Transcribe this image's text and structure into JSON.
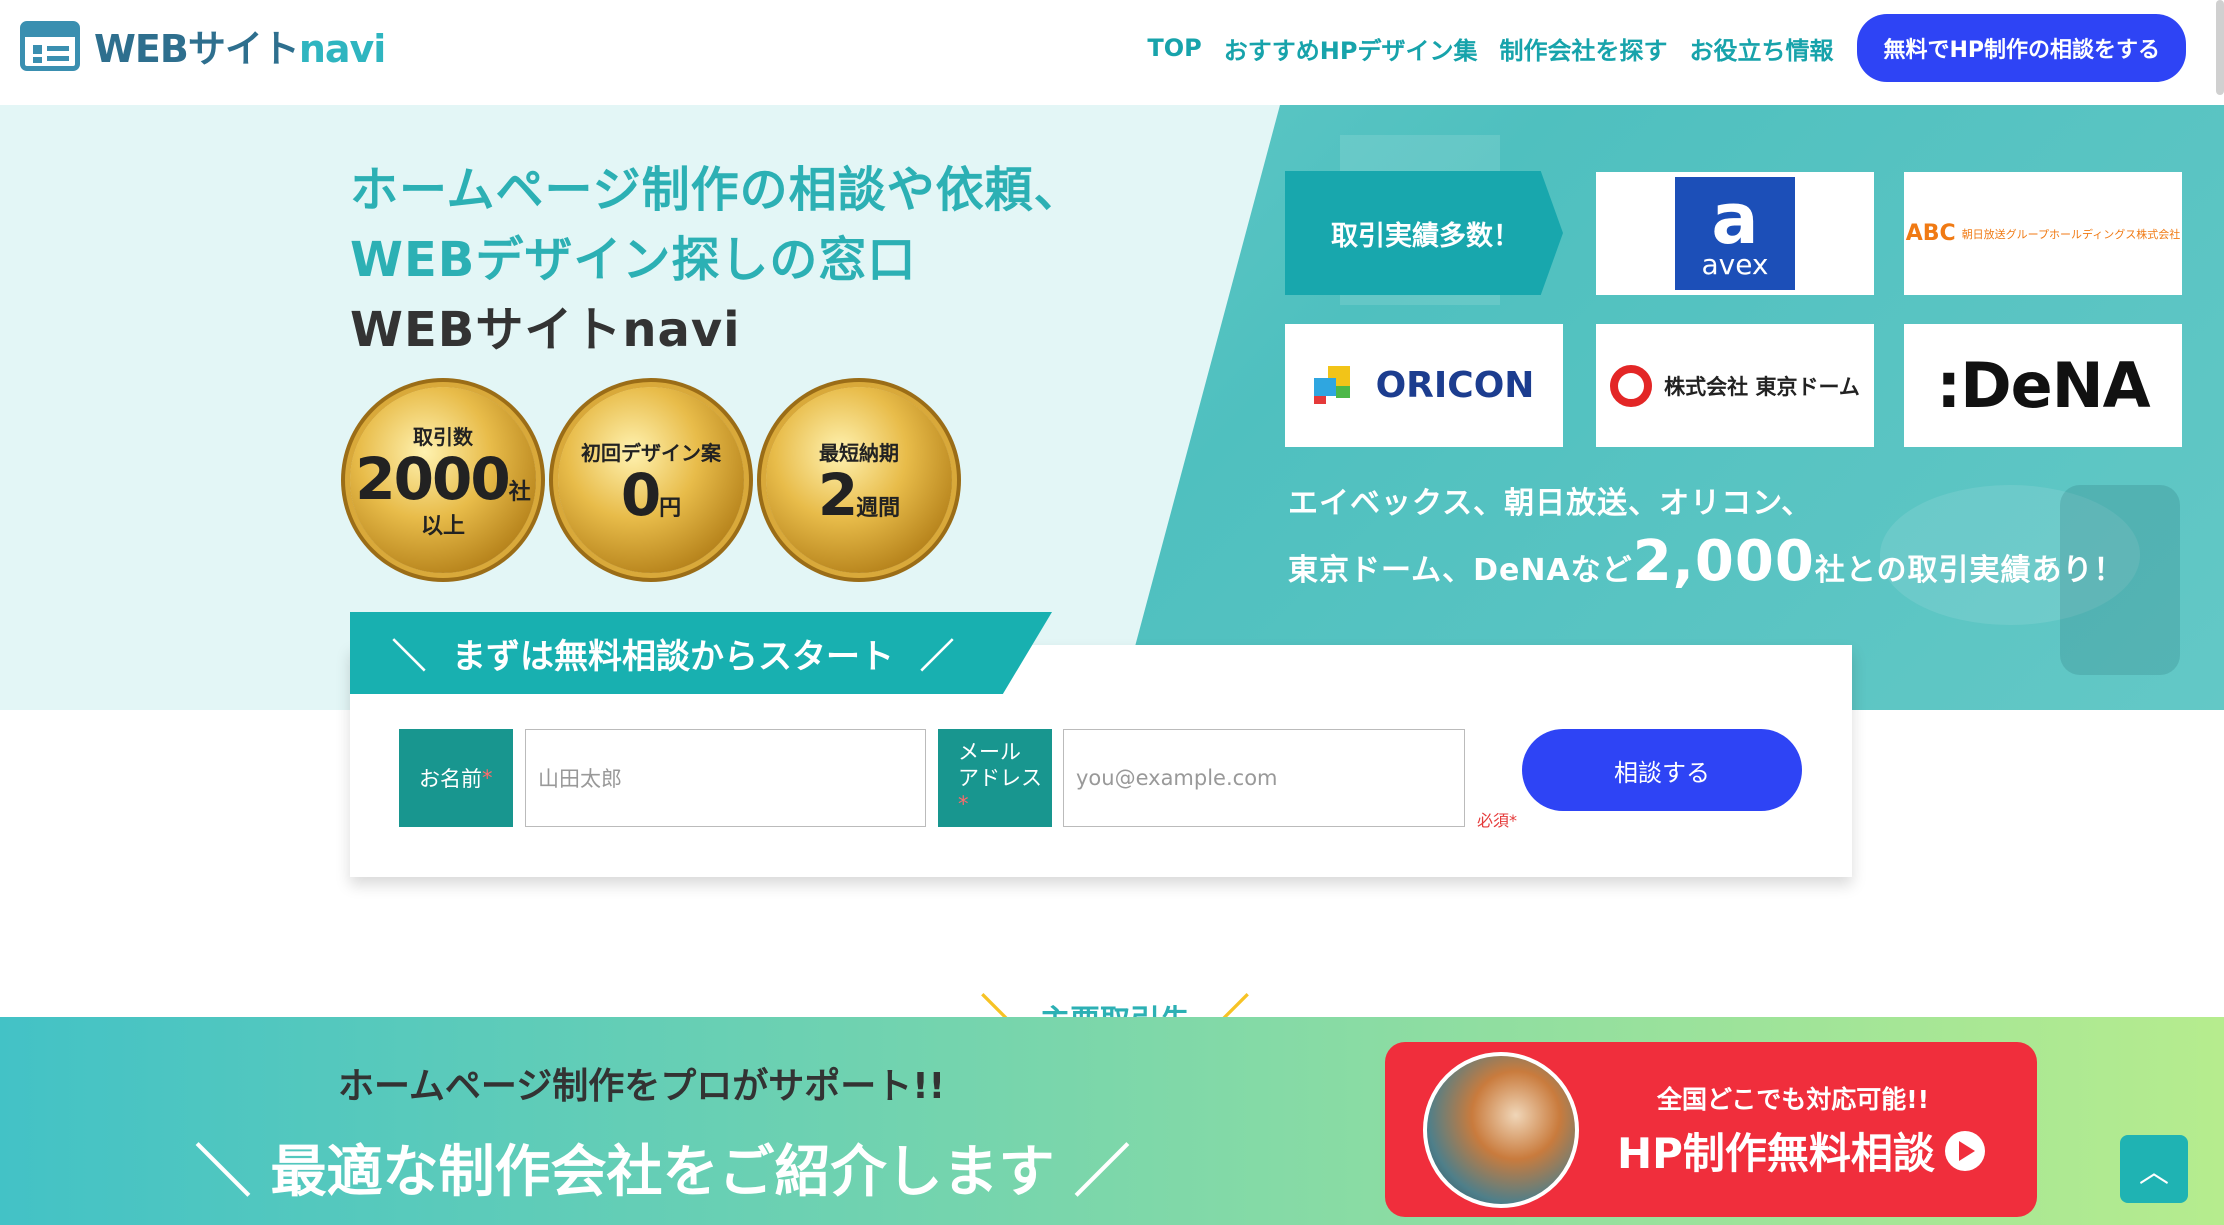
{
  "header": {
    "logo_main": "WEBサイト",
    "logo_accent": "navi",
    "nav": [
      "TOP",
      "おすすめHPデザイン集",
      "制作会社を探す",
      "お役立ち情報"
    ],
    "cta": "無料でHP制作の相談をする"
  },
  "hero": {
    "title_line1": "ホームページ制作の相談や依頼、",
    "title_line2": "WEBデザイン探しの窓口",
    "title_line3": "WEBサイトnavi",
    "medals": [
      {
        "top": "取引数",
        "big": "2000",
        "unit": "社",
        "bottom": "以上"
      },
      {
        "top": "初回デザイン案",
        "big": "0",
        "unit": "円",
        "bottom": ""
      },
      {
        "top": "最短納期",
        "big": "2",
        "unit": "週間",
        "bottom": ""
      }
    ],
    "deal_label": "取引実績多数！",
    "clients": {
      "avex_mark": "a",
      "avex": "avex",
      "abc": "ABC",
      "abc_sub": "朝日放送グループホールディングス株式会社",
      "oricon": "ORICON",
      "tokyo_dome": "株式会社 東京ドーム",
      "dena": ":DeNA"
    },
    "client_text_line1": "エイベックス、朝日放送、オリコン、",
    "client_text_line2a": "東京ドーム、DeNAなど",
    "client_text_big": "2,000",
    "client_text_line2b": "社との取引実績あり！"
  },
  "consult": {
    "tab_label": "まずは無料相談からスタート",
    "name_label": "お名前",
    "name_placeholder": "山田太郎",
    "email_label_1": "メール",
    "email_label_2": "アドレス",
    "required_mark": "*",
    "email_placeholder": "you@example.com",
    "required_note": "必須*",
    "submit": "相談する"
  },
  "partners_title": "主要取引先",
  "banner": {
    "sub": "ホームページ制作をプロがサポート!!",
    "main": "最適な制作会社をご紹介します",
    "card_small": "全国どこでも対応可能!!",
    "card_big": "HP制作無料相談"
  },
  "colors": {
    "teal": "#18a7ad",
    "blue": "#2e44f5",
    "red": "#f02e3c"
  }
}
